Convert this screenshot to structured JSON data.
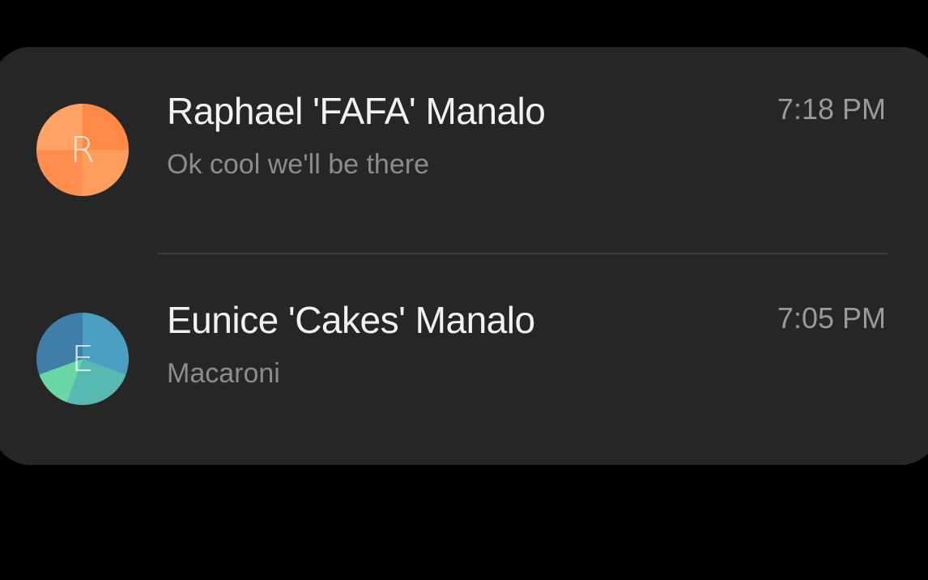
{
  "conversations": [
    {
      "avatar_letter": "R",
      "avatar_color": "#ff9350",
      "name": "Raphael 'FAFA' Manalo",
      "time": "7:18 PM",
      "preview": "Ok cool we'll be there"
    },
    {
      "avatar_letter": "E",
      "avatar_color": "#4fa7b8",
      "name": "Eunice 'Cakes' Manalo",
      "time": "7:05 PM",
      "preview": "Macaroni"
    }
  ],
  "colors": {
    "background": "#000000",
    "card": "#262626",
    "name_text": "#f2f2f2",
    "secondary_text": "#8c8c8c",
    "divider": "#3c3c3c"
  }
}
